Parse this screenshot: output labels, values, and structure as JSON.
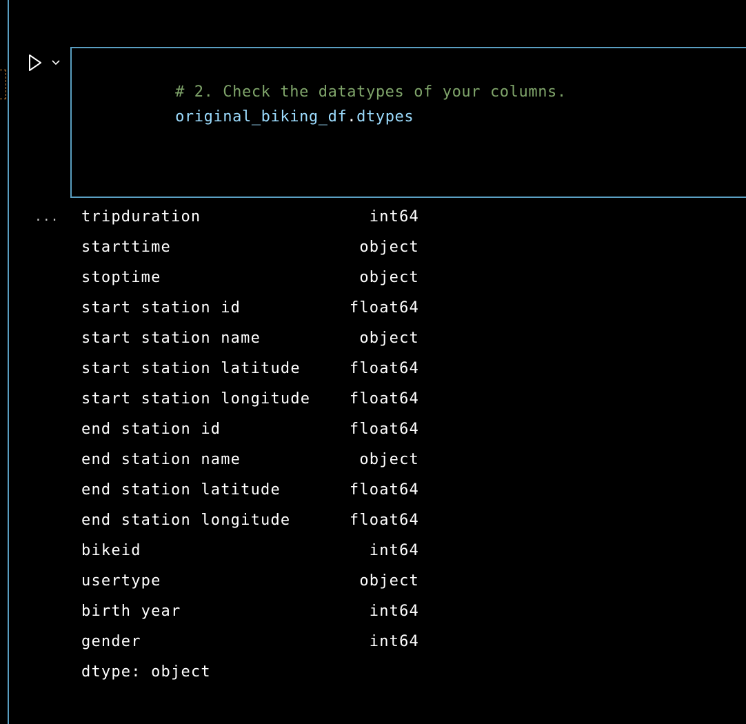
{
  "cell": {
    "code_comment": "# 2. Check the datatypes of your columns.",
    "code_var": "original_biking_df",
    "code_dot": ".",
    "code_attr": "dtypes"
  },
  "output": {
    "ellipsis": "...",
    "rows": [
      {
        "name": "tripduration",
        "type": "int64"
      },
      {
        "name": "starttime",
        "type": "object"
      },
      {
        "name": "stoptime",
        "type": "object"
      },
      {
        "name": "start station id",
        "type": "float64"
      },
      {
        "name": "start station name",
        "type": "object"
      },
      {
        "name": "start station latitude",
        "type": "float64"
      },
      {
        "name": "start station longitude",
        "type": "float64"
      },
      {
        "name": "end station id",
        "type": "float64"
      },
      {
        "name": "end station name",
        "type": "object"
      },
      {
        "name": "end station latitude",
        "type": "float64"
      },
      {
        "name": "end station longitude",
        "type": "float64"
      },
      {
        "name": "bikeid",
        "type": "int64"
      },
      {
        "name": "usertype",
        "type": "object"
      },
      {
        "name": "birth year",
        "type": "int64"
      },
      {
        "name": "gender",
        "type": "int64"
      }
    ],
    "footer": "dtype: object"
  },
  "icons": {
    "run": "play-icon",
    "menu": "chevron-down-icon"
  },
  "colors": {
    "background": "#000000",
    "focus_border": "#5a9fc2",
    "comment": "#7fa46a",
    "variable": "#9cdcfe",
    "text": "#ffffff"
  }
}
